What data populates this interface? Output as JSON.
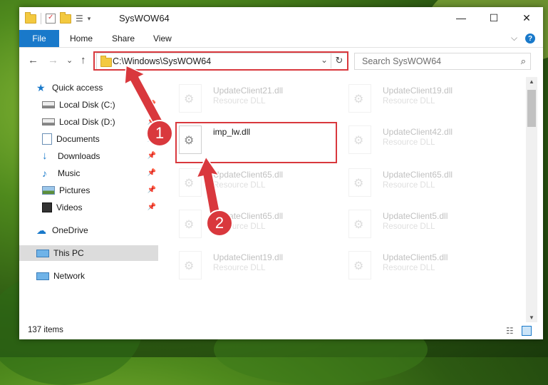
{
  "window": {
    "title": "SysWOW64",
    "minimize": "—",
    "maximize": "☐",
    "close": "✕"
  },
  "ribbon": {
    "tabs": [
      "File",
      "Home",
      "Share",
      "View"
    ],
    "help": "?",
    "expand": "⌵"
  },
  "nav": {
    "back": "←",
    "forward": "→",
    "recent": "⌄",
    "up": "↑",
    "address": "C:\\Windows\\SysWOW64",
    "dropdown": "⌄",
    "refresh": "↻",
    "search_placeholder": "Search SysWOW64"
  },
  "sidebar": {
    "items": [
      {
        "label": "Quick access",
        "icon": "star-icon",
        "pinned": false
      },
      {
        "label": "Local Disk (C:)",
        "icon": "drive-icon",
        "pinned": true
      },
      {
        "label": "Local Disk (D:)",
        "icon": "drive-icon",
        "pinned": true
      },
      {
        "label": "Documents",
        "icon": "documents-icon",
        "pinned": true
      },
      {
        "label": "Downloads",
        "icon": "download-icon",
        "pinned": true
      },
      {
        "label": "Music",
        "icon": "music-icon",
        "pinned": true
      },
      {
        "label": "Pictures",
        "icon": "pictures-icon",
        "pinned": true
      },
      {
        "label": "Videos",
        "icon": "videos-icon",
        "pinned": true
      },
      {
        "label": "OneDrive",
        "icon": "cloud-icon",
        "pinned": false
      },
      {
        "label": "This PC",
        "icon": "pc-icon",
        "pinned": false
      },
      {
        "label": "Network",
        "icon": "network-icon",
        "pinned": false
      }
    ]
  },
  "files": [
    {
      "name": "UpdateClient21.dll",
      "type": "Resource DLL"
    },
    {
      "name": "UpdateClient19.dll",
      "type": "Resource DLL"
    },
    {
      "name": "imp_lw.dll",
      "type": ""
    },
    {
      "name": "UpdateClient42.dll",
      "type": "Resource DLL"
    },
    {
      "name": "UpdateClient65.dll",
      "type": "Resource DLL"
    },
    {
      "name": "UpdateClient65.dll",
      "type": "Resource DLL"
    },
    {
      "name": "UpdateClient65.dll",
      "type": "Resource DLL"
    },
    {
      "name": "UpdateClient5.dll",
      "type": "Resource DLL"
    },
    {
      "name": "UpdateClient19.dll",
      "type": "Resource DLL"
    },
    {
      "name": "UpdateClient5.dll",
      "type": "Resource DLL"
    }
  ],
  "status": {
    "items_count": "137 items"
  },
  "annotations": {
    "step1": "1",
    "step2": "2",
    "color": "#d9383d"
  }
}
